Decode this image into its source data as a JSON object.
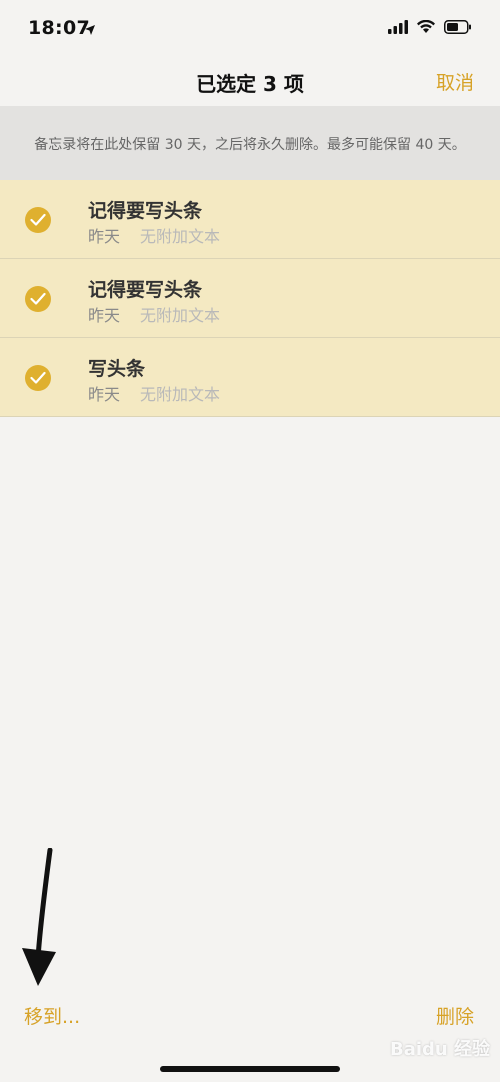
{
  "status_bar": {
    "time": "18:07"
  },
  "nav": {
    "title": "已选定 3 项",
    "cancel_label": "取消"
  },
  "banner": {
    "text": "备忘录将在此处保留 30 天，之后将永久删除。最多可能保留 40 天。"
  },
  "notes": [
    {
      "title": "记得要写头条",
      "date": "昨天",
      "preview": "无附加文本",
      "selected": true
    },
    {
      "title": "记得要写头条",
      "date": "昨天",
      "preview": "无附加文本",
      "selected": true
    },
    {
      "title": "写头条",
      "date": "昨天",
      "preview": "无附加文本",
      "selected": true
    }
  ],
  "toolbar": {
    "move_label": "移到...",
    "delete_label": "删除"
  },
  "watermark": {
    "text": "Baidu 经验"
  },
  "colors": {
    "accent": "#d7a227",
    "selected_bg": "#f4e9c2",
    "check": "#dfb02f"
  },
  "icons": {
    "location": "location-arrow-icon",
    "cellular": "cellular-signal-icon",
    "wifi": "wifi-icon",
    "battery": "battery-icon",
    "check": "checkmark-icon"
  }
}
